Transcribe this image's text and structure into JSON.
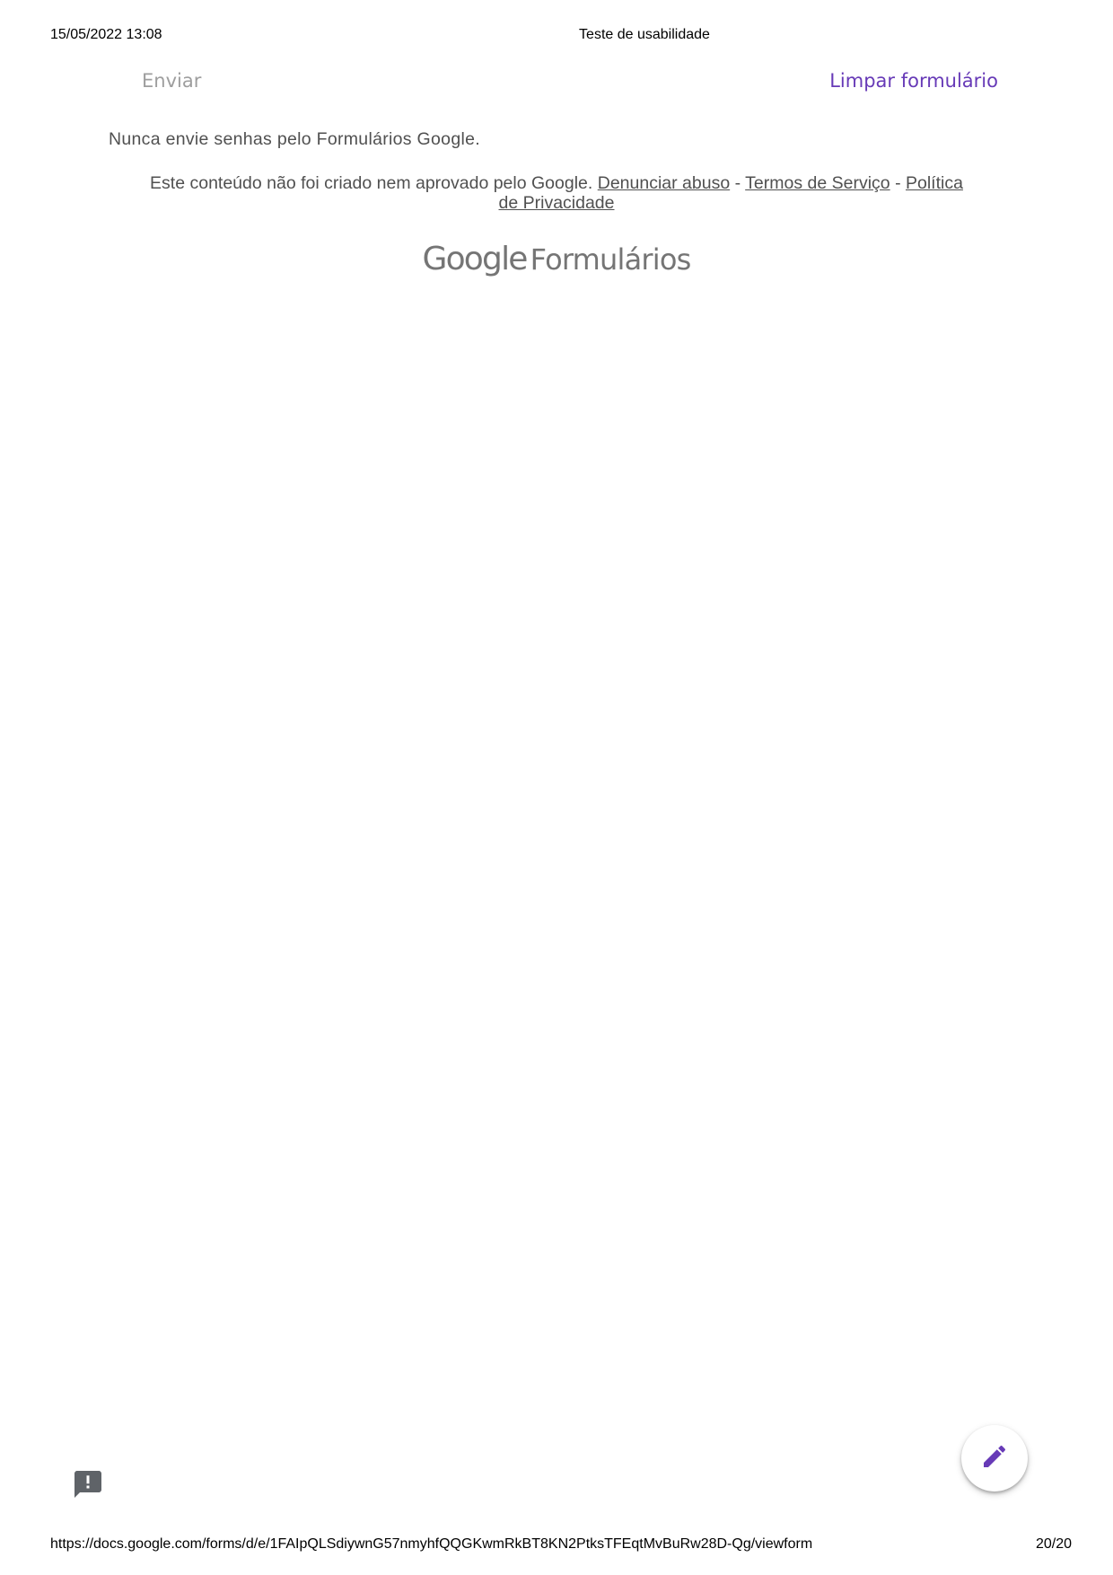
{
  "print_header": {
    "datetime": "15/05/2022 13:08",
    "title": "Teste de usabilidade"
  },
  "form_actions": {
    "submit_label": "Enviar",
    "clear_label": "Limpar formulário"
  },
  "password_warning": "Nunca envie senhas pelo Formulários Google.",
  "disclaimer": {
    "text": "Este conteúdo não foi criado nem aprovado pelo Google.",
    "report_abuse_link": "Denunciar abuso",
    "separator": "-",
    "terms_link": "Termos de Serviço",
    "privacy_link": "Política de Privacidade"
  },
  "branding": {
    "google": "Google",
    "product": "Formulários"
  },
  "icons": {
    "report": "report-problem-icon",
    "edit": "edit-pencil-icon"
  },
  "colors": {
    "accent": "#673ab7",
    "disabled_text": "#9e9e9e",
    "body_text": "#505050",
    "icon_gray": "#5f6368"
  },
  "print_footer": {
    "url": "https://docs.google.com/forms/d/e/1FAIpQLSdiywnG57nmyhfQQGKwmRkBT8KN2PtksTFEqtMvBuRw28D-Qg/viewform",
    "page": "20/20"
  }
}
